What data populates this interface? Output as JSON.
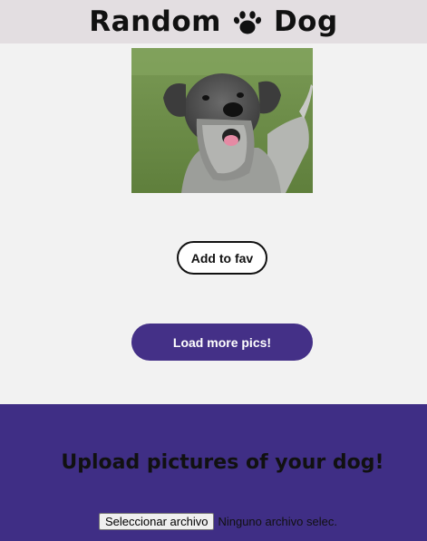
{
  "header": {
    "title_left": "Random",
    "title_right": "Dog",
    "icon": "paw-icon"
  },
  "photo": {
    "alt": "dog-photo"
  },
  "buttons": {
    "add_fav": "Add to fav",
    "load_more": "Load more pics!"
  },
  "upload": {
    "title": "Upload pictures of your dog!",
    "file_button": "Seleccionar archivo",
    "file_status": "Ninguno archivo selec."
  },
  "colors": {
    "header_bg": "#e3dee1",
    "page_bg": "#f2f2f2",
    "accent": "#443087",
    "section_bg": "#3f2e85"
  }
}
